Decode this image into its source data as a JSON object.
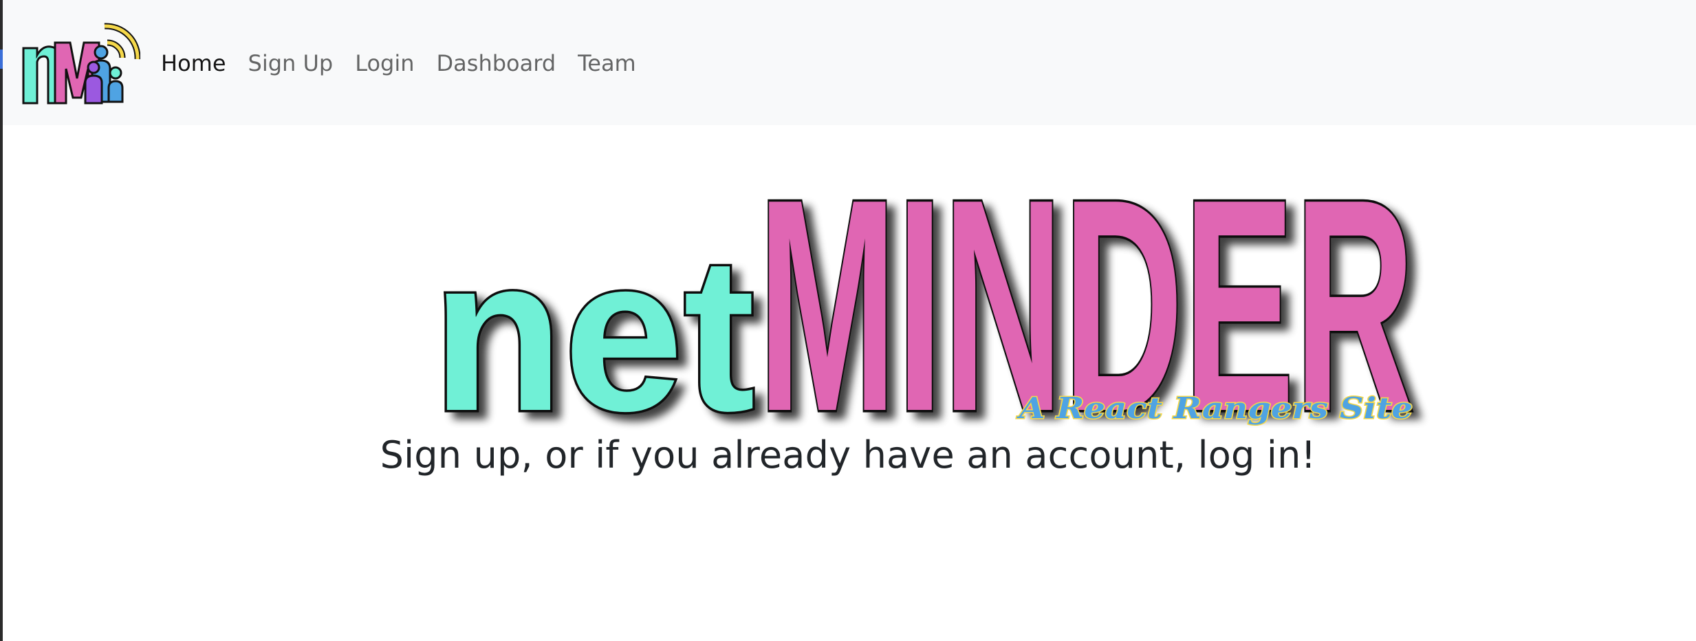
{
  "nav": {
    "brand_logo": {
      "text": "nM",
      "colors": {
        "n": "#6ff0d6",
        "M": "#e066b3",
        "people": [
          "#9b59e0",
          "#4fa3e3",
          "#6ff0d6"
        ],
        "signal": "#f5d84a"
      }
    },
    "links": [
      {
        "label": "Home",
        "active": true
      },
      {
        "label": "Sign Up",
        "active": false
      },
      {
        "label": "Login",
        "active": false
      },
      {
        "label": "Dashboard",
        "active": false
      },
      {
        "label": "Team",
        "active": false
      }
    ]
  },
  "hero": {
    "logo_part1": "net",
    "logo_part2": "MINDER",
    "logo_subtitle": "A React Rangers Site",
    "colors": {
      "net": "#6ff0d6",
      "minder": "#e066b3",
      "outline": "#111111",
      "subtitle": "#4fa3e3",
      "subtitle_outline": "#f5d84a"
    }
  },
  "main": {
    "tagline": "Sign up, or if you already have an account, log in!"
  }
}
